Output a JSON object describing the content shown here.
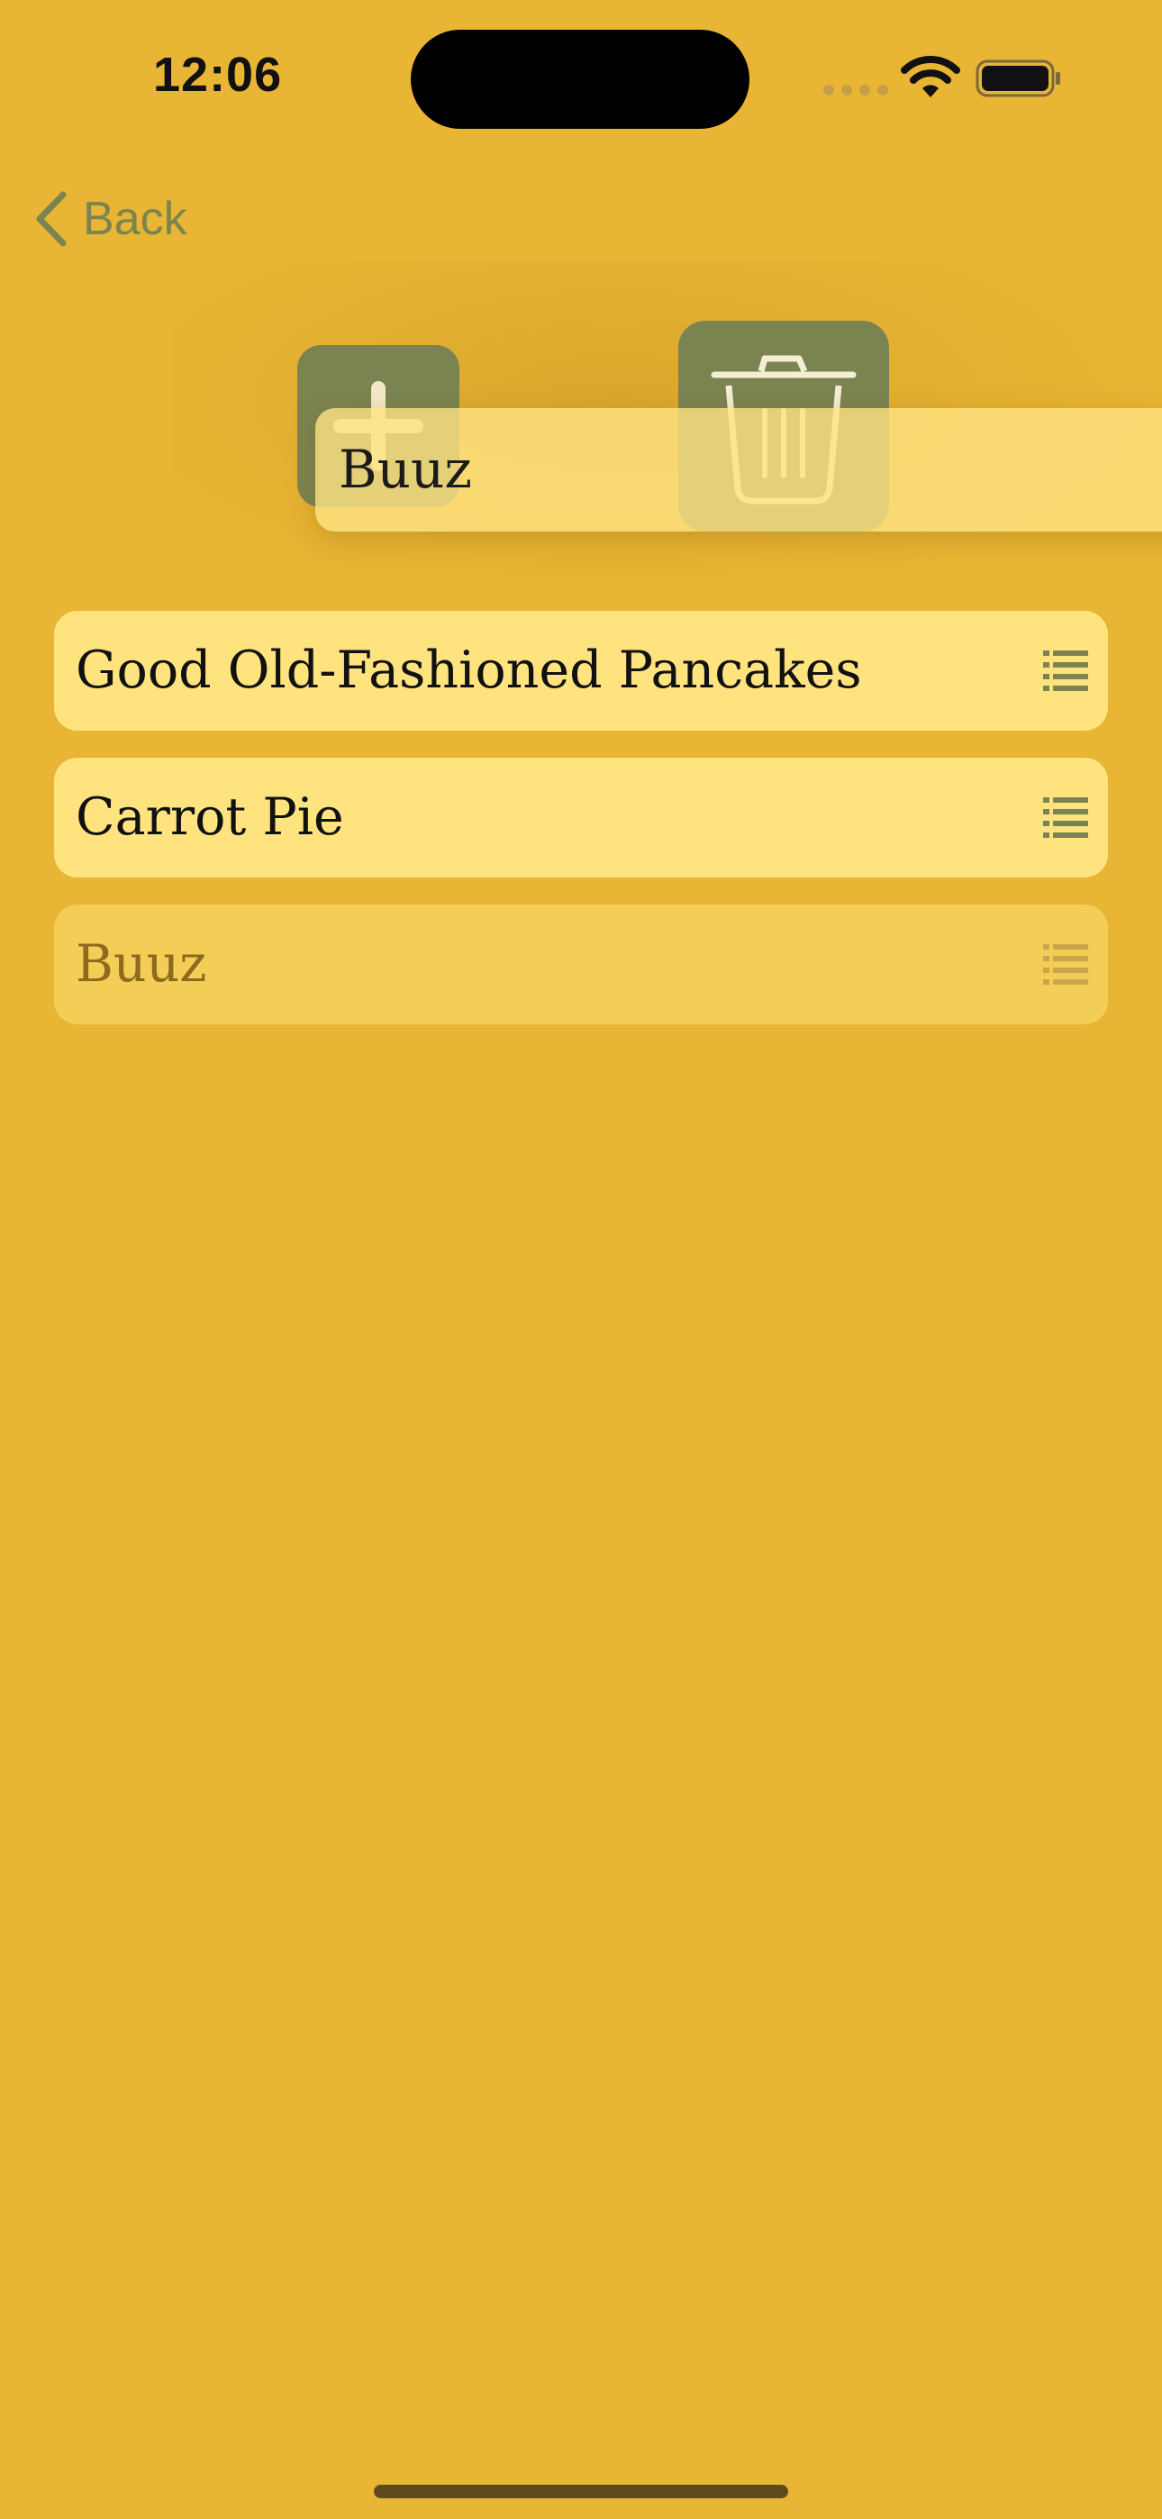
{
  "status_bar": {
    "time": "12:06"
  },
  "nav": {
    "back_label": "Back"
  },
  "actions": {
    "add_icon": "plus-icon",
    "delete_icon": "trash-icon"
  },
  "drag_preview": {
    "label": "Buuz"
  },
  "recipes": [
    {
      "title": "Good Old-Fashioned Pancakes",
      "state": "normal"
    },
    {
      "title": "Carrot Pie",
      "state": "normal"
    },
    {
      "title": "Buuz",
      "state": "dragging-placeholder"
    }
  ],
  "colors": {
    "background": "#E8B534",
    "row": "#FFE37E",
    "row_dimmed": "#F3CD56",
    "accent_green": "#7B8451",
    "text": "#111111"
  }
}
